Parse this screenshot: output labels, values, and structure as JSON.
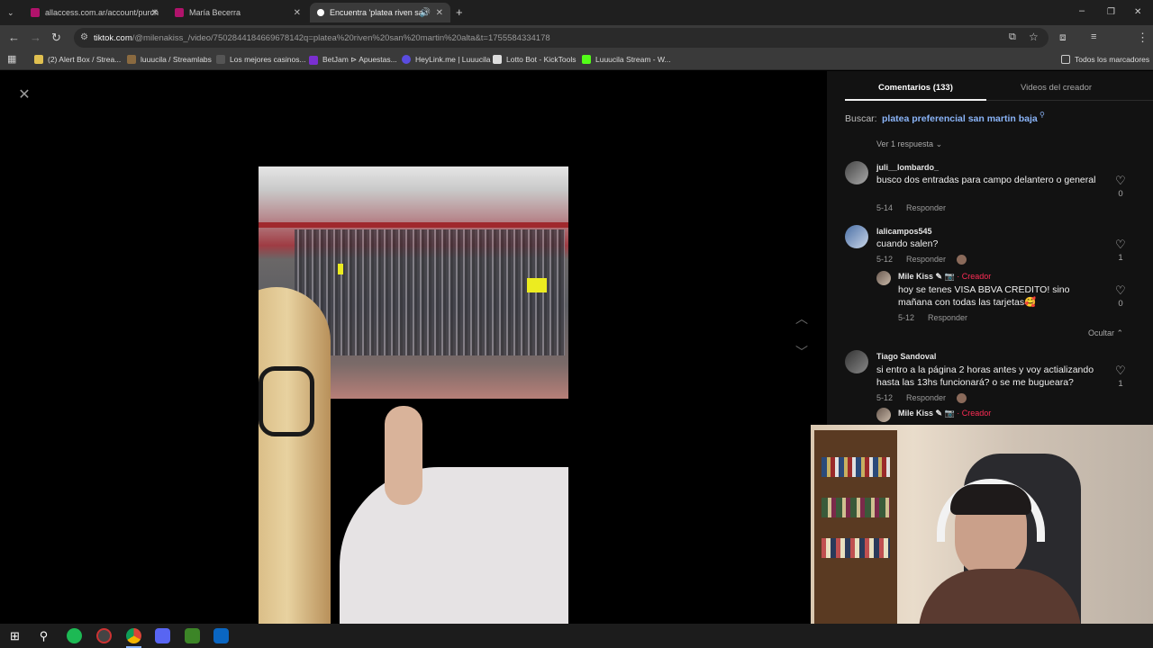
{
  "browser": {
    "tabs": [
      {
        "title": "allaccess.com.ar/account/purch",
        "favicon_color": "#b0136b"
      },
      {
        "title": "María Becerra",
        "favicon_color": "#b0136b"
      },
      {
        "title": "Encuentra 'platea riven san",
        "favicon_color": "#ffffff"
      }
    ],
    "url_host": "tiktok.com",
    "url_path": "/@milenakiss_/video/7502844184669678142q=platea%20riven%20san%20martin%20alta&t=1755584334178",
    "bookmarks": [
      "(2) Alert Box / Strea...",
      "luuucila / Streamlabs",
      "Los mejores casinos...",
      "BetJam ⊳ Apuestas...",
      "HeyLink.me | Luuucila",
      "Lotto Bot - KickTools",
      "Luuucila Stream - W..."
    ],
    "bookmarks_all": "Todos los marcadores"
  },
  "panel": {
    "tab_comments": "Comentarios (133)",
    "tab_creator_videos": "Videos del creador",
    "search_label": "Buscar:",
    "search_query": "platea preferencial san martin baja",
    "view_replies": "Ver 1 respuesta",
    "hide_label": "Ocultar",
    "creator_label": "· Creador",
    "reply_label": "Responder",
    "comments": [
      {
        "user": "juli__lombardo_",
        "text": "busco dos entradas para campo delantero o general",
        "date": "5-14",
        "likes": "0"
      },
      {
        "user": "lalicampos545",
        "text": "cuando salen?",
        "date": "5-12",
        "likes": "1"
      },
      {
        "user": "Mile Kiss ✎ 📷",
        "text": "hoy se tenes VISA BBVA CREDITO! sino mañana con todas las tarjetas🥰",
        "date": "5-12",
        "likes": "0"
      },
      {
        "user": "Tiago Sandoval",
        "text": "si entro a la página 2 horas antes y voy actializando hasta las 13hs funcionará? o se me bugueara?",
        "date": "5-12",
        "likes": "1"
      },
      {
        "user": "Mile Kiss ✎ 📷",
        "text": "",
        "date": "",
        "likes": ""
      }
    ]
  },
  "icons": {
    "close": "close-icon",
    "up": "chevron-up-icon",
    "down": "chevron-down-icon"
  }
}
